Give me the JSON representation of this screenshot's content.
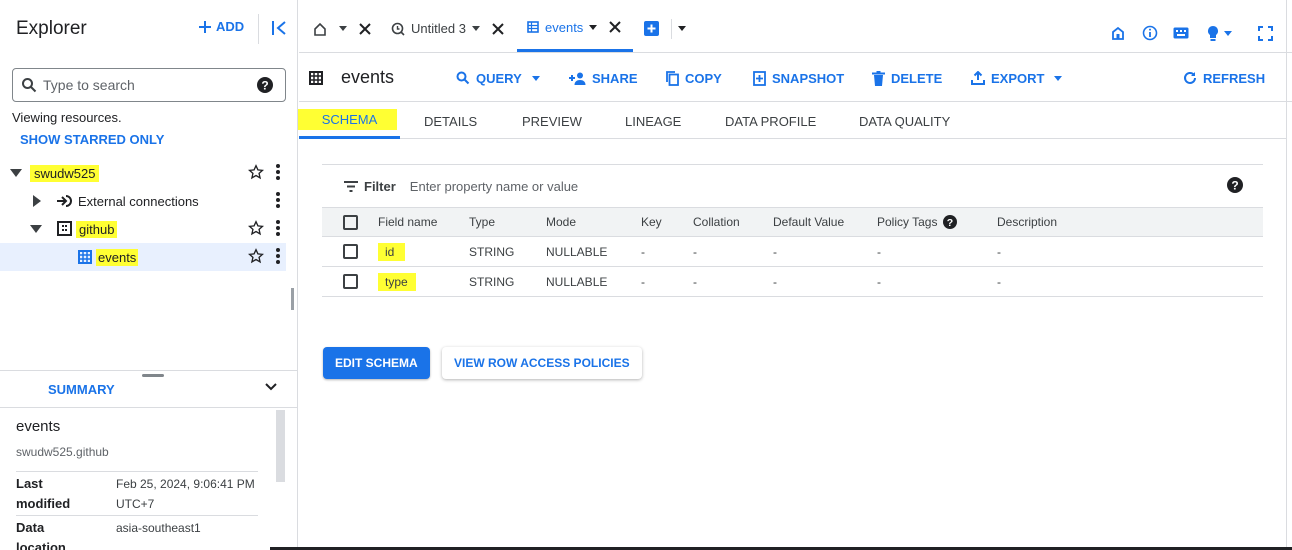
{
  "explorer": {
    "title": "Explorer",
    "add_label": "ADD",
    "search_placeholder": "Type to search",
    "viewing_text": "Viewing resources.",
    "show_starred": "SHOW STARRED ONLY",
    "tree": [
      {
        "label": "swudw525",
        "type": "project"
      },
      {
        "label": "External connections",
        "type": "connections"
      },
      {
        "label": "github",
        "type": "dataset"
      },
      {
        "label": "events",
        "type": "table"
      }
    ]
  },
  "summary": {
    "label": "SUMMARY",
    "title": "events",
    "subtitle": "swudw525.github",
    "rows": [
      {
        "key": "Last modified",
        "value": "Feb 25, 2024, 9:06:41 PM UTC+7"
      },
      {
        "key": "Data location",
        "value": "asia-southeast1"
      }
    ]
  },
  "tabs": [
    {
      "label": "Untitled 3",
      "icon": "query-icon"
    },
    {
      "label": "events",
      "icon": "table-icon",
      "active": true
    }
  ],
  "toolbar": {
    "title": "events",
    "query": "QUERY",
    "share": "SHARE",
    "copy": "COPY",
    "snapshot": "SNAPSHOT",
    "delete": "DELETE",
    "export": "EXPORT",
    "refresh": "REFRESH"
  },
  "subtabs": [
    "SCHEMA",
    "DETAILS",
    "PREVIEW",
    "LINEAGE",
    "DATA PROFILE",
    "DATA QUALITY"
  ],
  "schema": {
    "filter_label": "Filter",
    "filter_placeholder": "Enter property name or value",
    "columns": [
      "Field name",
      "Type",
      "Mode",
      "Key",
      "Collation",
      "Default Value",
      "Policy Tags",
      "Description"
    ],
    "rows": [
      [
        "id",
        "STRING",
        "NULLABLE",
        "-",
        "-",
        "-",
        "-",
        "-"
      ],
      [
        "type",
        "STRING",
        "NULLABLE",
        "-",
        "-",
        "-",
        "-",
        "-"
      ]
    ]
  },
  "buttons": {
    "edit_schema": "EDIT SCHEMA",
    "view_row_access": "VIEW ROW ACCESS POLICIES"
  },
  "colors": {
    "accent": "#1a73e8",
    "highlight": "#ffff33",
    "selected_row": "#e8f0fe"
  }
}
